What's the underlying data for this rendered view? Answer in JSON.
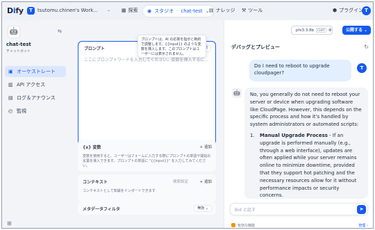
{
  "header": {
    "logo": "Dify",
    "workspace_initial": "T",
    "workspace_name": "tsutomu.chinen's Work...",
    "nav_explore": "探索",
    "nav_studio": "スタジオ",
    "nav_app": "chat-test",
    "nav_knowledge": "ナレッジ",
    "nav_tools": "ツール",
    "nav_plugins": "プラグイン",
    "user_initial": "T"
  },
  "sidebar": {
    "app_name": "chat-test",
    "app_type": "チャットボット",
    "items": [
      {
        "label": "オーケストレート",
        "active": true
      },
      {
        "label": "API アクセス",
        "active": false
      },
      {
        "label": "ログ＆アナウンス",
        "active": false
      },
      {
        "label": "監視",
        "active": false
      }
    ],
    "footer_icon": "⊞"
  },
  "editor": {
    "tooltip": "プロンプトは、AI の応答を指示と制約で調整します。{{input}} のような変数を挿入します。このプロンプトはユーザーには表示されません。",
    "prompt_title": "プロンプト",
    "prompt_generate": "自動",
    "prompt_placeholder": "ここにプロンプトワードを入力してください。変数を挿入するには'{{'を、プロンプ...",
    "prompt_count": "0",
    "variables_title": "変数",
    "variables_add": "+ 追加",
    "variables_desc": "変数を使用すると、ユーザーはフォームに入力する際にプロンプトの単語や開始の言葉を導入できます。プロンプトの単語に \"{{input}}\" を入力してみてください。",
    "context_title": "コンテキスト",
    "context_retrieval": "検索設定",
    "context_add": "+ 追加",
    "context_desc": "コンテキストとして知識をインポートできます",
    "metadata_title": "メタデータフィルタ",
    "metadata_value": "無効 ⌄"
  },
  "debug": {
    "model_name": "phi3:3.8b",
    "model_badge": "CHAT",
    "publish_label": "公開する ⌄",
    "title": "デバッグとプレビュー",
    "user_message": "Do I need to reboot to upgrade cloudpager?",
    "user_initial": "T",
    "bot_p1": "No, you generally do not need to reboot your server or device when upgrading software like CloudPage. However, this depends on the specific process and how it's handled by system administrators or automated scripts:",
    "bot_list_num": "1.",
    "bot_list_title": "Manual Upgrade Process",
    "bot_list_body": " - If an upgrade is performed manually (e.g., through a web interface), updates are often applied while your server remains online to minimize downtime, provided that they support hot patching and the necessary resources allow for it without performance impacts or security concerns.",
    "input_placeholder": "Bot と話す",
    "feature_label": "有効な機能",
    "feature_manage": "管理 ›"
  }
}
